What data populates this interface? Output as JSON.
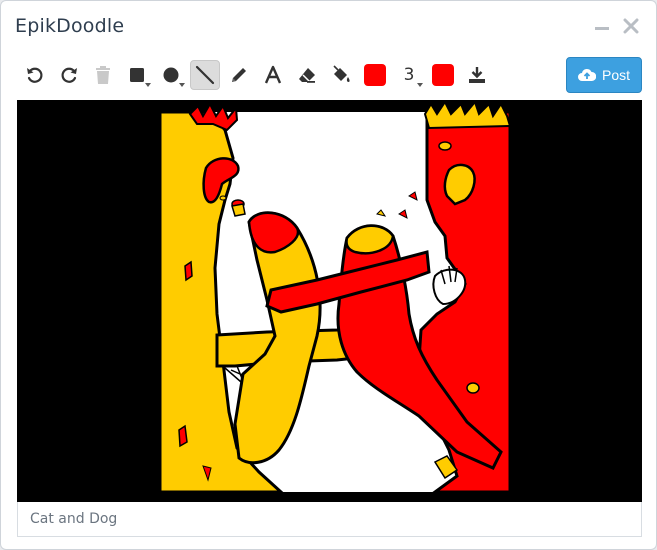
{
  "app": {
    "title": "EpikDoodle"
  },
  "window_controls": [
    "minimize-icon",
    "close-icon"
  ],
  "toolbar": {
    "tools": [
      {
        "name": "undo",
        "icon": "undo-icon"
      },
      {
        "name": "redo",
        "icon": "redo-icon"
      },
      {
        "name": "delete",
        "icon": "trash-icon",
        "disabled": true
      },
      {
        "name": "rectangle",
        "icon": "square-icon"
      },
      {
        "name": "ellipse",
        "icon": "circle-icon"
      },
      {
        "name": "line",
        "icon": "line-icon",
        "active": true
      },
      {
        "name": "pencil",
        "icon": "pencil-icon"
      },
      {
        "name": "text",
        "icon": "text-icon"
      },
      {
        "name": "eraser",
        "icon": "eraser-icon"
      },
      {
        "name": "fill",
        "icon": "paint-bucket-icon"
      },
      {
        "name": "primary-color",
        "icon": "color-swatch"
      },
      {
        "name": "brush-size",
        "icon": "size-selector"
      },
      {
        "name": "secondary-color",
        "icon": "color-swatch"
      },
      {
        "name": "download",
        "icon": "download-icon"
      }
    ],
    "primary_color": "#ff0000",
    "secondary_color": "#ff0000",
    "brush_size": "3",
    "post_label": "Post",
    "post_icon": "cloud-upload-icon"
  },
  "colors": {
    "accent": "#3da0e0",
    "drawing_yellow": "#ffcc00",
    "drawing_red": "#ff0000",
    "drawing_background": "#000000"
  },
  "caption": {
    "value": "Cat and Dog",
    "placeholder": ""
  }
}
